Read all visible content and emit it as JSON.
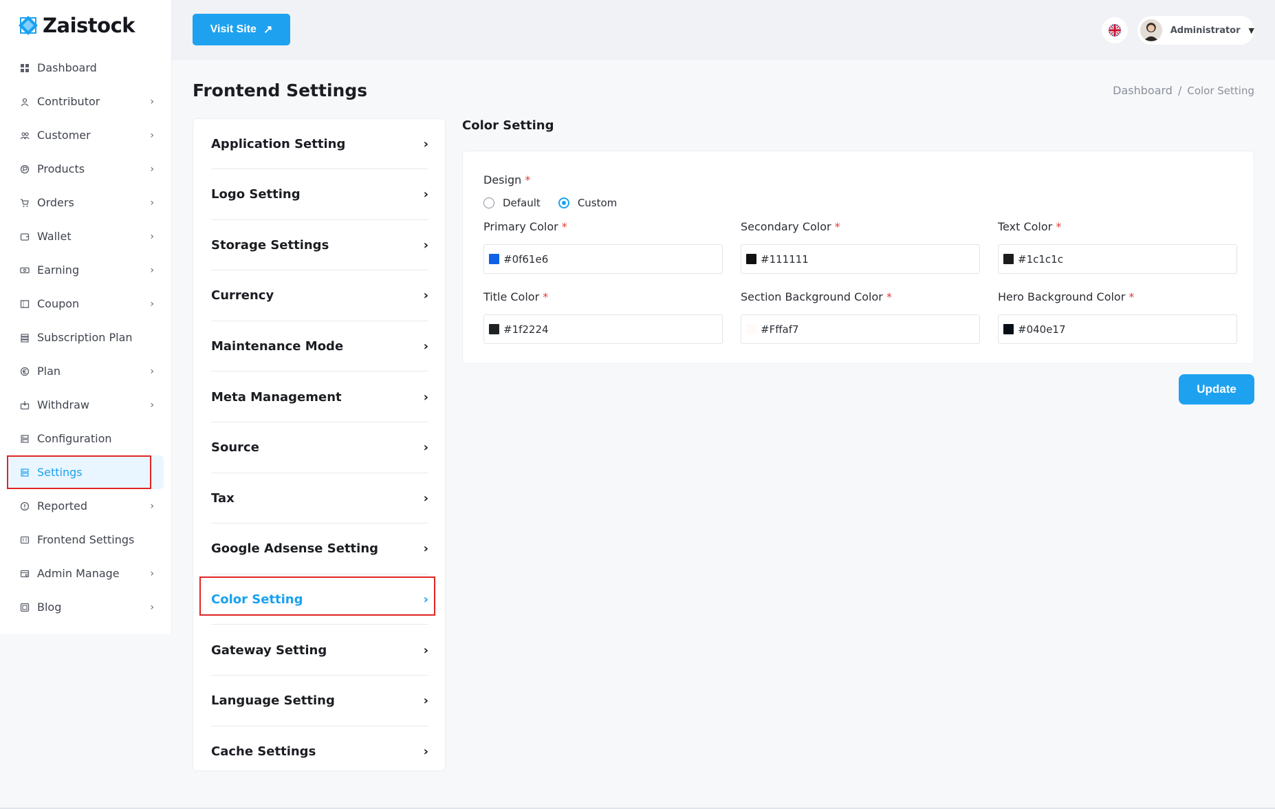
{
  "brand": {
    "name": "Zaistock",
    "color": "#1aa1f0"
  },
  "sidebar": {
    "items": [
      {
        "label": "Dashboard",
        "icon": "grid-icon",
        "chevron": false
      },
      {
        "label": "Contributor",
        "icon": "user-icon",
        "chevron": true
      },
      {
        "label": "Customer",
        "icon": "users-icon",
        "chevron": true
      },
      {
        "label": "Products",
        "icon": "product-icon",
        "chevron": true
      },
      {
        "label": "Orders",
        "icon": "cart-icon",
        "chevron": true
      },
      {
        "label": "Wallet",
        "icon": "wallet-icon",
        "chevron": true
      },
      {
        "label": "Earning",
        "icon": "money-icon",
        "chevron": true
      },
      {
        "label": "Coupon",
        "icon": "coupon-icon",
        "chevron": true
      },
      {
        "label": "Subscription Plan",
        "icon": "stack-icon",
        "chevron": false
      },
      {
        "label": "Plan",
        "icon": "euro-icon",
        "chevron": true
      },
      {
        "label": "Withdraw",
        "icon": "withdraw-icon",
        "chevron": true
      },
      {
        "label": "Configuration",
        "icon": "config-icon",
        "chevron": false
      },
      {
        "label": "Settings",
        "icon": "settings-icon",
        "chevron": false,
        "active": true
      },
      {
        "label": "Reported",
        "icon": "alert-icon",
        "chevron": true
      },
      {
        "label": "Frontend Settings",
        "icon": "frontend-icon",
        "chevron": false
      },
      {
        "label": "Admin Manage",
        "icon": "admin-icon",
        "chevron": true
      },
      {
        "label": "Blog",
        "icon": "blog-icon",
        "chevron": true
      }
    ]
  },
  "header": {
    "visit_site": "Visit Site",
    "language_icon": "uk-flag-icon",
    "user_name": "Administrator"
  },
  "page": {
    "title": "Frontend Settings",
    "breadcrumb": {
      "home": "Dashboard",
      "separator": "/",
      "current": "Color Setting"
    }
  },
  "settings_menu": [
    "Application Setting",
    "Logo Setting",
    "Storage Settings",
    "Currency",
    "Maintenance Mode",
    "Meta Management",
    "Source",
    "Tax",
    "Google Adsense Setting",
    "Color Setting",
    "Gateway Setting",
    "Language Setting",
    "Cache Settings"
  ],
  "settings_menu_active": "Color Setting",
  "color_setting": {
    "title": "Color Setting",
    "design_label": "Design",
    "design_options": [
      "Default",
      "Custom"
    ],
    "design_selected": "Custom",
    "required_mark": "*",
    "fields": [
      {
        "label": "Primary Color",
        "value": "#0f61e6",
        "swatch": "#0f61e6"
      },
      {
        "label": "Secondary Color",
        "value": "#111111",
        "swatch": "#111111"
      },
      {
        "label": "Text Color",
        "value": "#1c1c1c",
        "swatch": "#1c1c1c"
      },
      {
        "label": "Title Color",
        "value": "#1f2224",
        "swatch": "#1f2224"
      },
      {
        "label": "Section Background Color",
        "value": "#Fffaf7",
        "swatch": "#fffaf7"
      },
      {
        "label": "Hero Background Color",
        "value": "#040e17",
        "swatch": "#040e17"
      }
    ],
    "update_label": "Update"
  }
}
